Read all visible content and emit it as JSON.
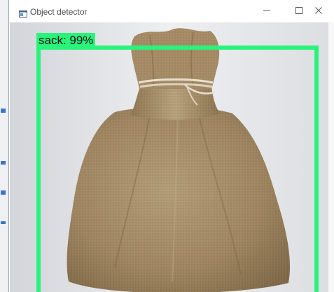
{
  "window": {
    "title": "Object detector",
    "controls": {
      "minimize_icon": "minimize-icon",
      "maximize_icon": "maximize-icon",
      "close_icon": "close-icon"
    }
  },
  "detection": {
    "label": "sack: 99%",
    "box_color": "#2af37b"
  },
  "colors": {
    "accent": "#2af37b",
    "title_text": "#4a4a4a"
  }
}
